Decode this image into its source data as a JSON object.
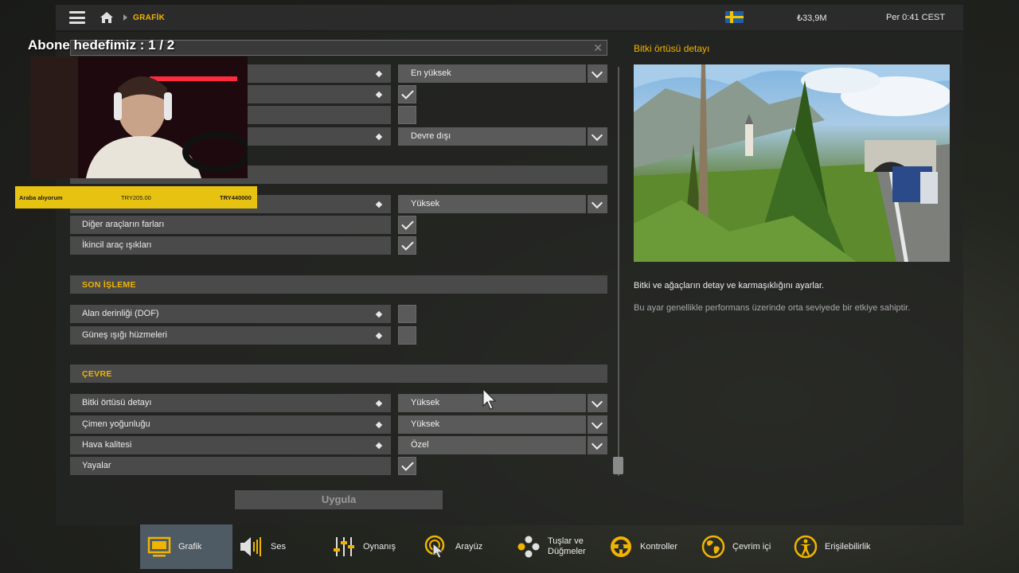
{
  "topbar": {
    "breadcrumb": "GRAFİK",
    "money": "₺33,9M",
    "clock": "Per 0:41 CEST"
  },
  "overlay": {
    "abone_text": "Abone hedefimiz : 1 / 2",
    "donation": {
      "label": "Araba alıyorum",
      "current": "TRY205.00",
      "goal": "TRY440000"
    }
  },
  "settings": {
    "hidden_rows": [
      {
        "value": "En yüksek"
      },
      {
        "checked": true
      },
      {
        "checked": false
      },
      {
        "value": "Devre dışı"
      }
    ],
    "hidden_row_2": {
      "value": "Yüksek"
    },
    "lights": [
      {
        "label": "Diğer araçların farları",
        "checked": true
      },
      {
        "label": "İkincil araç ışıkları",
        "checked": true
      }
    ],
    "post_processing": {
      "title": "SON İŞLEME",
      "items": [
        {
          "label": "Alan derinliği (DOF)",
          "checked": false
        },
        {
          "label": "Güneş ışığı hüzmeleri",
          "checked": false
        }
      ]
    },
    "environment": {
      "title": "ÇEVRE",
      "items": [
        {
          "label": "Bitki örtüsü detayı",
          "value": "Yüksek"
        },
        {
          "label": "Çimen yoğunluğu",
          "value": "Yüksek"
        },
        {
          "label": "Hava kalitesi",
          "value": "Özel"
        },
        {
          "label": "Yayalar",
          "checked": true
        }
      ]
    },
    "apply_label": "Uygula"
  },
  "detail": {
    "title": "Bitki örtüsü detayı",
    "description": "Bitki ve ağaçların detay ve karmaşıklığını ayarlar.",
    "note": "Bu ayar genellikle performans üzerinde orta seviyede bir etkiye sahiptir."
  },
  "nav": {
    "tabs": [
      {
        "label": "Grafik",
        "icon": "monitor-icon",
        "active": true
      },
      {
        "label": "Ses",
        "icon": "speaker-icon"
      },
      {
        "label": "Oynanış",
        "icon": "sliders-icon"
      },
      {
        "label": "Arayüz",
        "icon": "cursor-target-icon"
      },
      {
        "label": "Tuşlar ve Düğmeler",
        "icon": "gamepad-buttons-icon"
      },
      {
        "label": "Kontroller",
        "icon": "steering-wheel-icon"
      },
      {
        "label": "Çevrim içi",
        "icon": "globe-icon"
      },
      {
        "label": "Erişilebilirlik",
        "icon": "accessibility-icon"
      }
    ]
  },
  "colors": {
    "accent": "#f0b400",
    "row_bg": "#4a4a4a",
    "active_tab": "#4e5a64",
    "donation_bg": "#e8c211"
  }
}
